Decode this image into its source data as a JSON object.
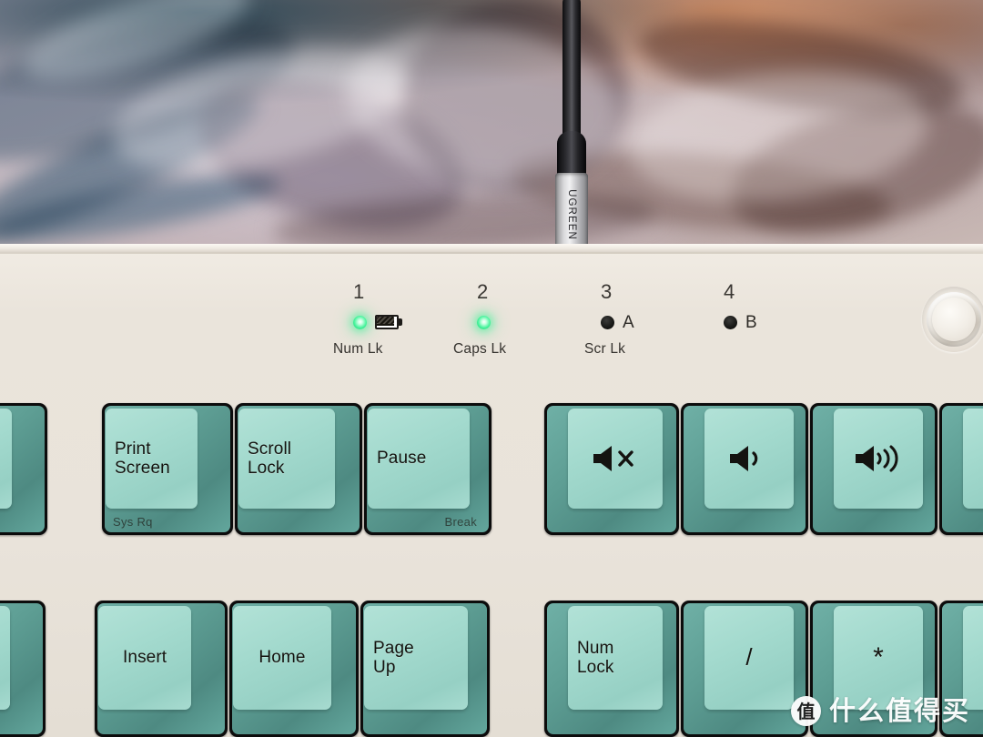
{
  "scene": {
    "device": "mechanical keyboard",
    "case_color": "#ece6dd",
    "keycap_top_color": "#a2d9cd",
    "keycap_skirt_color": "#5e9e94",
    "key_well_color": "#0c0c0c",
    "led_on_color": "#46f39b",
    "led_off_color": "#171715"
  },
  "cable": {
    "brand": "UGREEN",
    "connector_color": "#d9d9db",
    "wire_color": "#0d0d0f"
  },
  "indicators": [
    {
      "number": "1",
      "state": "on",
      "label": "Num Lk",
      "side": "",
      "icon": "battery-icon"
    },
    {
      "number": "2",
      "state": "on",
      "label": "Caps Lk",
      "side": "",
      "icon": ""
    },
    {
      "number": "3",
      "state": "off",
      "label": "Scr Lk",
      "side": "A",
      "icon": ""
    },
    {
      "number": "4",
      "state": "off",
      "label": "",
      "side": "B",
      "icon": ""
    }
  ],
  "knob": {
    "name": "rotary-knob"
  },
  "keys": {
    "row_top": [
      {
        "name": "key-f12-partial",
        "legend": "",
        "legend2": "",
        "sub": ""
      },
      {
        "name": "key-print-screen",
        "legend": "Print",
        "legend2": "Screen",
        "sub": "Sys Rq"
      },
      {
        "name": "key-scroll-lock",
        "legend": "Scroll",
        "legend2": "Lock",
        "sub": ""
      },
      {
        "name": "key-pause",
        "legend": "Pause",
        "legend2": "",
        "sub": "Break"
      },
      {
        "name": "key-mute",
        "legend": "",
        "legend2": "",
        "sub": "",
        "icon": "volume-mute-icon"
      },
      {
        "name": "key-volume-down",
        "legend": "",
        "legend2": "",
        "sub": "",
        "icon": "volume-down-icon"
      },
      {
        "name": "key-volume-up",
        "legend": "",
        "legend2": "",
        "sub": "",
        "icon": "volume-up-icon"
      },
      {
        "name": "key-media-extra",
        "legend": "",
        "legend2": "",
        "sub": ""
      }
    ],
    "row_bottom": [
      {
        "name": "key-left-partial",
        "legend": "",
        "legend2": "",
        "sub": ""
      },
      {
        "name": "key-insert",
        "legend": "Insert",
        "legend2": "",
        "sub": ""
      },
      {
        "name": "key-home",
        "legend": "Home",
        "legend2": "",
        "sub": ""
      },
      {
        "name": "key-page-up",
        "legend": "Page",
        "legend2": "Up",
        "sub": ""
      },
      {
        "name": "key-num-lock",
        "legend": "Num",
        "legend2": "Lock",
        "sub": ""
      },
      {
        "name": "key-divide",
        "legend": "/",
        "legend2": "",
        "sub": ""
      },
      {
        "name": "key-multiply",
        "legend": "*",
        "legend2": "",
        "sub": ""
      },
      {
        "name": "key-minus",
        "legend": "",
        "legend2": "",
        "sub": ""
      }
    ]
  },
  "watermark": {
    "badge": "值",
    "text": "什么值得买"
  }
}
